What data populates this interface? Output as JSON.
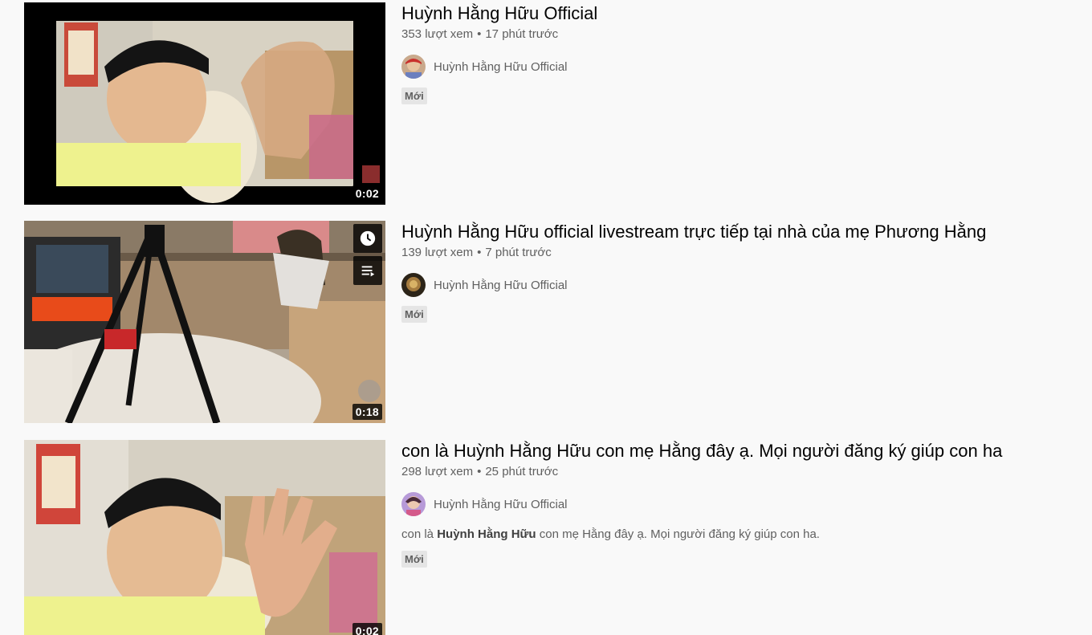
{
  "videos": [
    {
      "title": "Huỳnh Hằng Hữu Official",
      "views": "353 lượt xem",
      "time": "17 phút trước",
      "channel": "Huỳnh Hằng Hữu Official",
      "badge": "Mới",
      "duration": "0:02"
    },
    {
      "title": "Huỳnh Hằng Hữu official livestream trực tiếp tại nhà của mẹ Phương Hằng",
      "views": "139 lượt xem",
      "time": "7 phút trước",
      "channel": "Huỳnh Hằng Hữu Official",
      "badge": "Mới",
      "duration": "0:18",
      "hover_actions": [
        "clock-icon",
        "add-to-queue-icon"
      ]
    },
    {
      "title": "con là Huỳnh Hằng Hữu con mẹ Hằng đây ạ. Mọi người đăng ký giúp con ha",
      "views": "298 lượt xem",
      "time": "25 phút trước",
      "channel": "Huỳnh Hằng Hữu Official",
      "description_prefix": "con là ",
      "description_bold": "Huỳnh Hằng Hữu",
      "description_suffix": " con mẹ Hằng đây ạ. Mọi người đăng ký giúp con ha.",
      "badge": "Mới",
      "duration": "0:02"
    }
  ],
  "separator": "•"
}
